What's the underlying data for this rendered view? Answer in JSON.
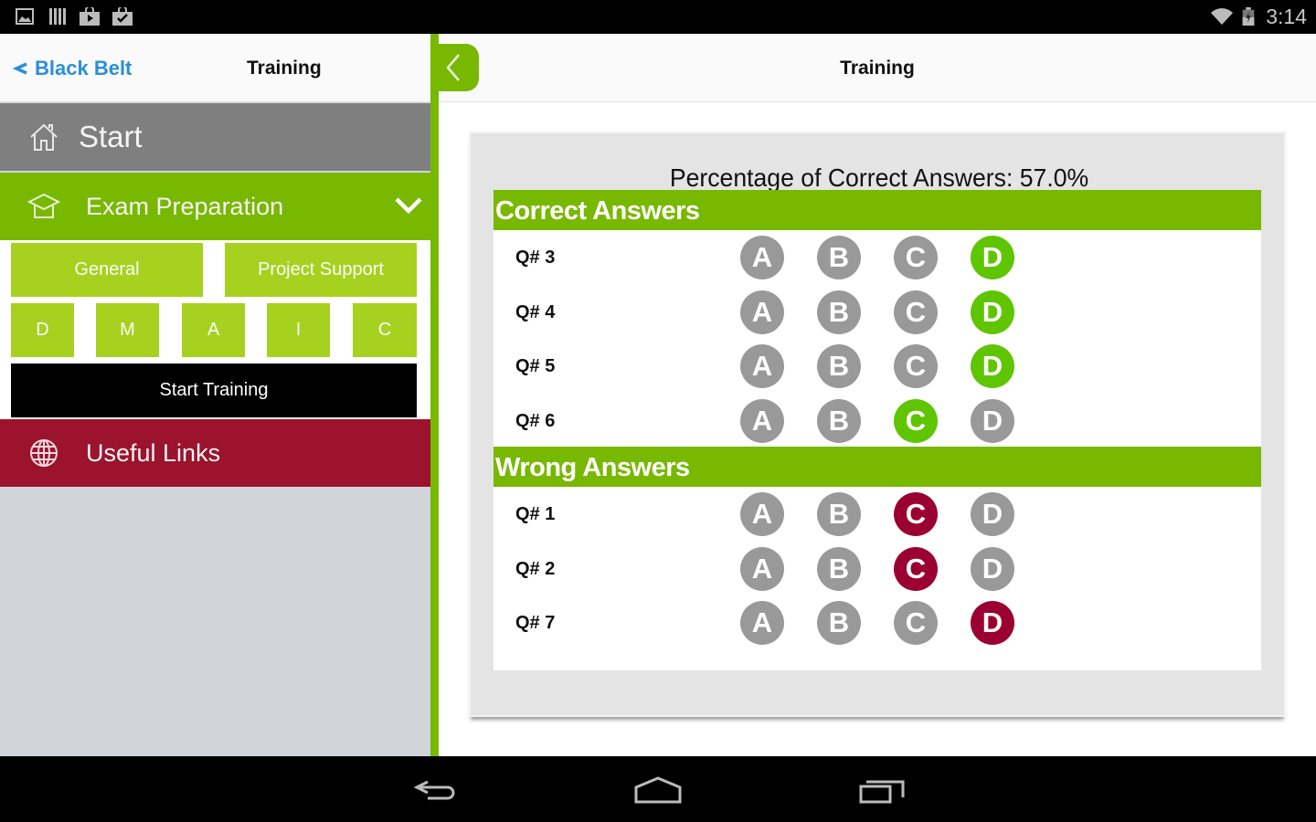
{
  "status_bar": {
    "time": "3:14",
    "left_icons": [
      "gallery-icon",
      "barcode-icon",
      "play-store-icon",
      "store-check-icon"
    ],
    "right_icons": [
      "wifi-icon",
      "battery-charging-icon"
    ]
  },
  "left_header": {
    "back_label": "Black Belt",
    "title": "Training"
  },
  "menu": {
    "start": {
      "label": "Start",
      "icon": "home-icon"
    },
    "exam": {
      "label": "Exam Preparation",
      "icon": "graduation-cap-icon",
      "expanded": true
    },
    "exam_buttons": {
      "general": "General",
      "project_support": "Project Support",
      "phases": [
        "D",
        "M",
        "A",
        "I",
        "C"
      ],
      "start_training": "Start Training"
    },
    "links": {
      "label": "Useful Links",
      "icon": "globe-icon"
    }
  },
  "right_header": {
    "title": "Training"
  },
  "results": {
    "percentage_label": "Percentage of Correct Answers:  57.0%",
    "options": [
      "A",
      "B",
      "C",
      "D"
    ],
    "correct_section": {
      "title": "Correct Answers",
      "questions": [
        {
          "label": "Q# 3",
          "selected": "D"
        },
        {
          "label": "Q# 4",
          "selected": "D"
        },
        {
          "label": "Q# 5",
          "selected": "D"
        },
        {
          "label": "Q# 6",
          "selected": "C"
        }
      ]
    },
    "wrong_section": {
      "title": "Wrong Answers",
      "questions": [
        {
          "label": "Q# 1",
          "selected": "C"
        },
        {
          "label": "Q# 2",
          "selected": "C"
        },
        {
          "label": "Q# 7",
          "selected": "D"
        }
      ]
    }
  },
  "colors": {
    "brand_green": "#78b800",
    "light_green": "#a7d11f",
    "correct": "#5ec500",
    "wrong": "#9b0032",
    "neutral_option": "#999999",
    "links_red": "#9b132d",
    "back_blue": "#2b8fd6"
  }
}
